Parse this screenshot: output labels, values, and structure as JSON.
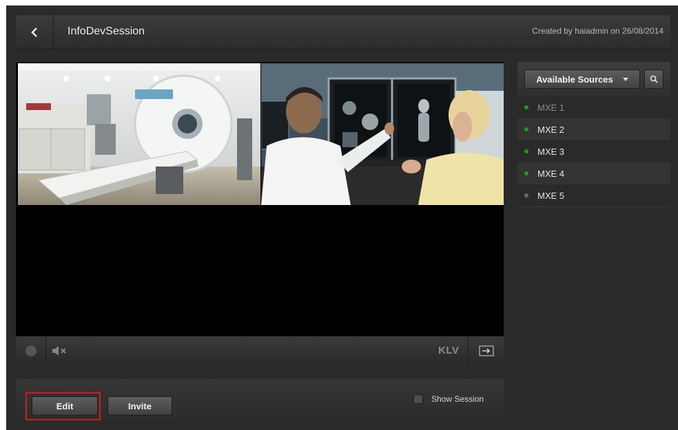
{
  "header": {
    "title": "InfoDevSession",
    "created_text": "Created by haiadmin on 26/08/2014"
  },
  "player": {
    "klv_label": "KLV"
  },
  "actions": {
    "edit_label": "Edit",
    "invite_label": "Invite",
    "show_session_label": "Show Session",
    "show_session_checked": false
  },
  "sources": {
    "dropdown_label": "Available Sources",
    "items": [
      {
        "label": "MXE 1",
        "status_color": "#1e9e1e",
        "dimmed": true
      },
      {
        "label": "MXE 2",
        "status_color": "#1e9e1e",
        "dimmed": false
      },
      {
        "label": "MXE 3",
        "status_color": "#1e9e1e",
        "dimmed": false
      },
      {
        "label": "MXE 4",
        "status_color": "#1e9e1e",
        "dimmed": false
      },
      {
        "label": "MXE 5",
        "status_color": "#6b6b6b",
        "dimmed": false
      }
    ]
  },
  "icons": {
    "back": "chevron-left-icon",
    "record": "record-icon",
    "mute": "speaker-muted-icon",
    "route": "route-arrow-icon",
    "search": "search-icon",
    "dropdown": "caret-down-icon"
  },
  "colors": {
    "highlight": "#d7191e",
    "online": "#1e9e1e",
    "offline": "#6b6b6b"
  }
}
